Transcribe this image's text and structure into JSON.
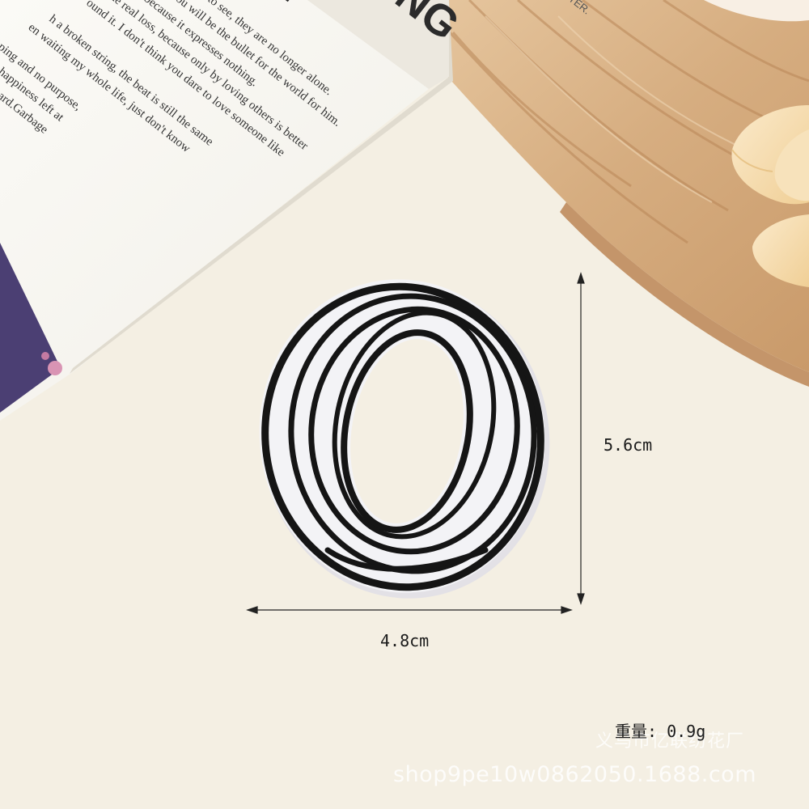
{
  "dimensions": {
    "width_label": "4.8cm",
    "height_label": "5.6cm",
    "weight_label": "重量: 0.9g"
  },
  "watermark": {
    "shop_name": "义乌市亿联纺花厂",
    "shop_url": "shop9pe10w0862050.1688.com"
  },
  "book_page": {
    "headline_top": "ERE",
    "headline_side": "DING",
    "corner_text": "OME BETTER.",
    "lines": [
      "who want to see, they are no longer alone.",
      "oone, you will be the bullet for the world for him.",
      "ling because it expresses nothing.",
      "the real loss, because only by loving others is better",
      "ound it. I don't think you dare to love someone like",
      "h a broken string, the beat is still the same",
      "en waiting my whole life, just don't know",
      "pping and no purpose,",
      "nd the happiness left at",
      "ause work hard.Garbage"
    ]
  },
  "colors": {
    "background": "#f4efe3",
    "patch_fill": "#f3f3f6",
    "patch_stitch": "#151515",
    "wood": "#d9b48a",
    "flower": "#f6dcae"
  },
  "icons": [
    "embroidered-letter-o-patch",
    "flower-icon",
    "wood-board"
  ]
}
